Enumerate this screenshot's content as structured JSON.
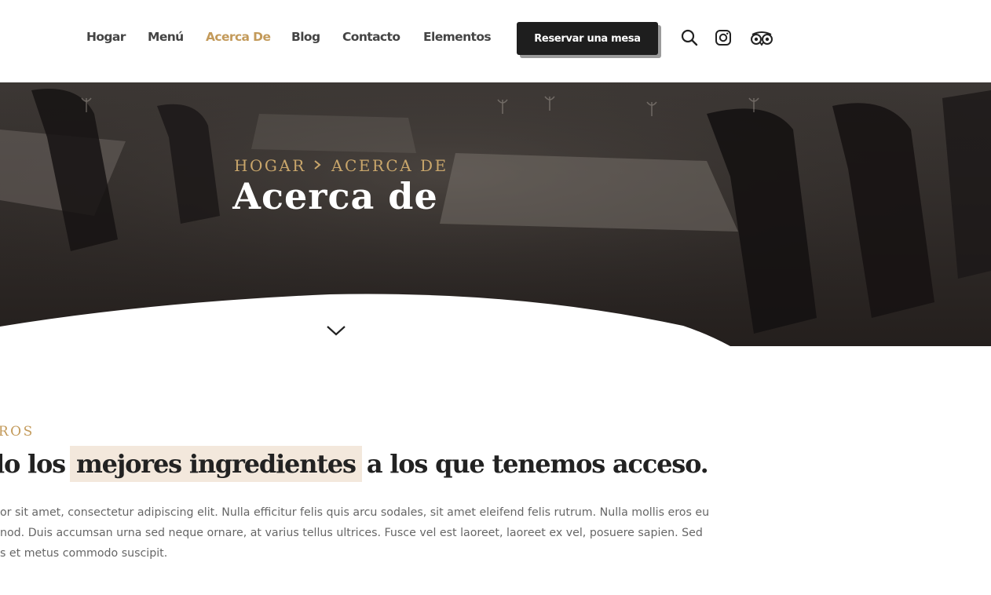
{
  "nav": {
    "items": [
      {
        "label": "Hogar",
        "active": false
      },
      {
        "label": "Menú",
        "active": false
      },
      {
        "label": "Acerca De",
        "active": true
      },
      {
        "label": "Blog",
        "active": false
      },
      {
        "label": "Contacto",
        "active": false
      },
      {
        "label": "Elementos",
        "active": false
      }
    ],
    "cta_label": "Reservar una mesa",
    "icons": [
      "search-icon",
      "instagram-icon",
      "tripadvisor-icon"
    ]
  },
  "hero": {
    "breadcrumb": [
      "HOGAR",
      "ACERCA DE"
    ],
    "title": "Acerca de"
  },
  "content": {
    "eyebrow": "TROS",
    "headline_before": "lo los",
    "headline_highlight": "mejores ingredientes",
    "headline_after": "a los que tenemos acceso.",
    "paragraph_lines": [
      "or sit amet, consectetur adipiscing elit. Nulla efficitur felis quis arcu sodales, sit amet eleifend felis rutrum. Nulla mollis eros eu",
      "nod. Duis accumsan urna sed neque ornare, at varius tellus ultrices. Fusce vel est laoreet, laoreet ex vel, posuere sapien. Sed",
      "s et metus commodo suscipit."
    ]
  },
  "colors": {
    "accent": "#c39a5a",
    "breadcrumb": "#c9a66b",
    "dark_button": "#1e1e1e",
    "highlight_bg": "#f3e8dc"
  }
}
